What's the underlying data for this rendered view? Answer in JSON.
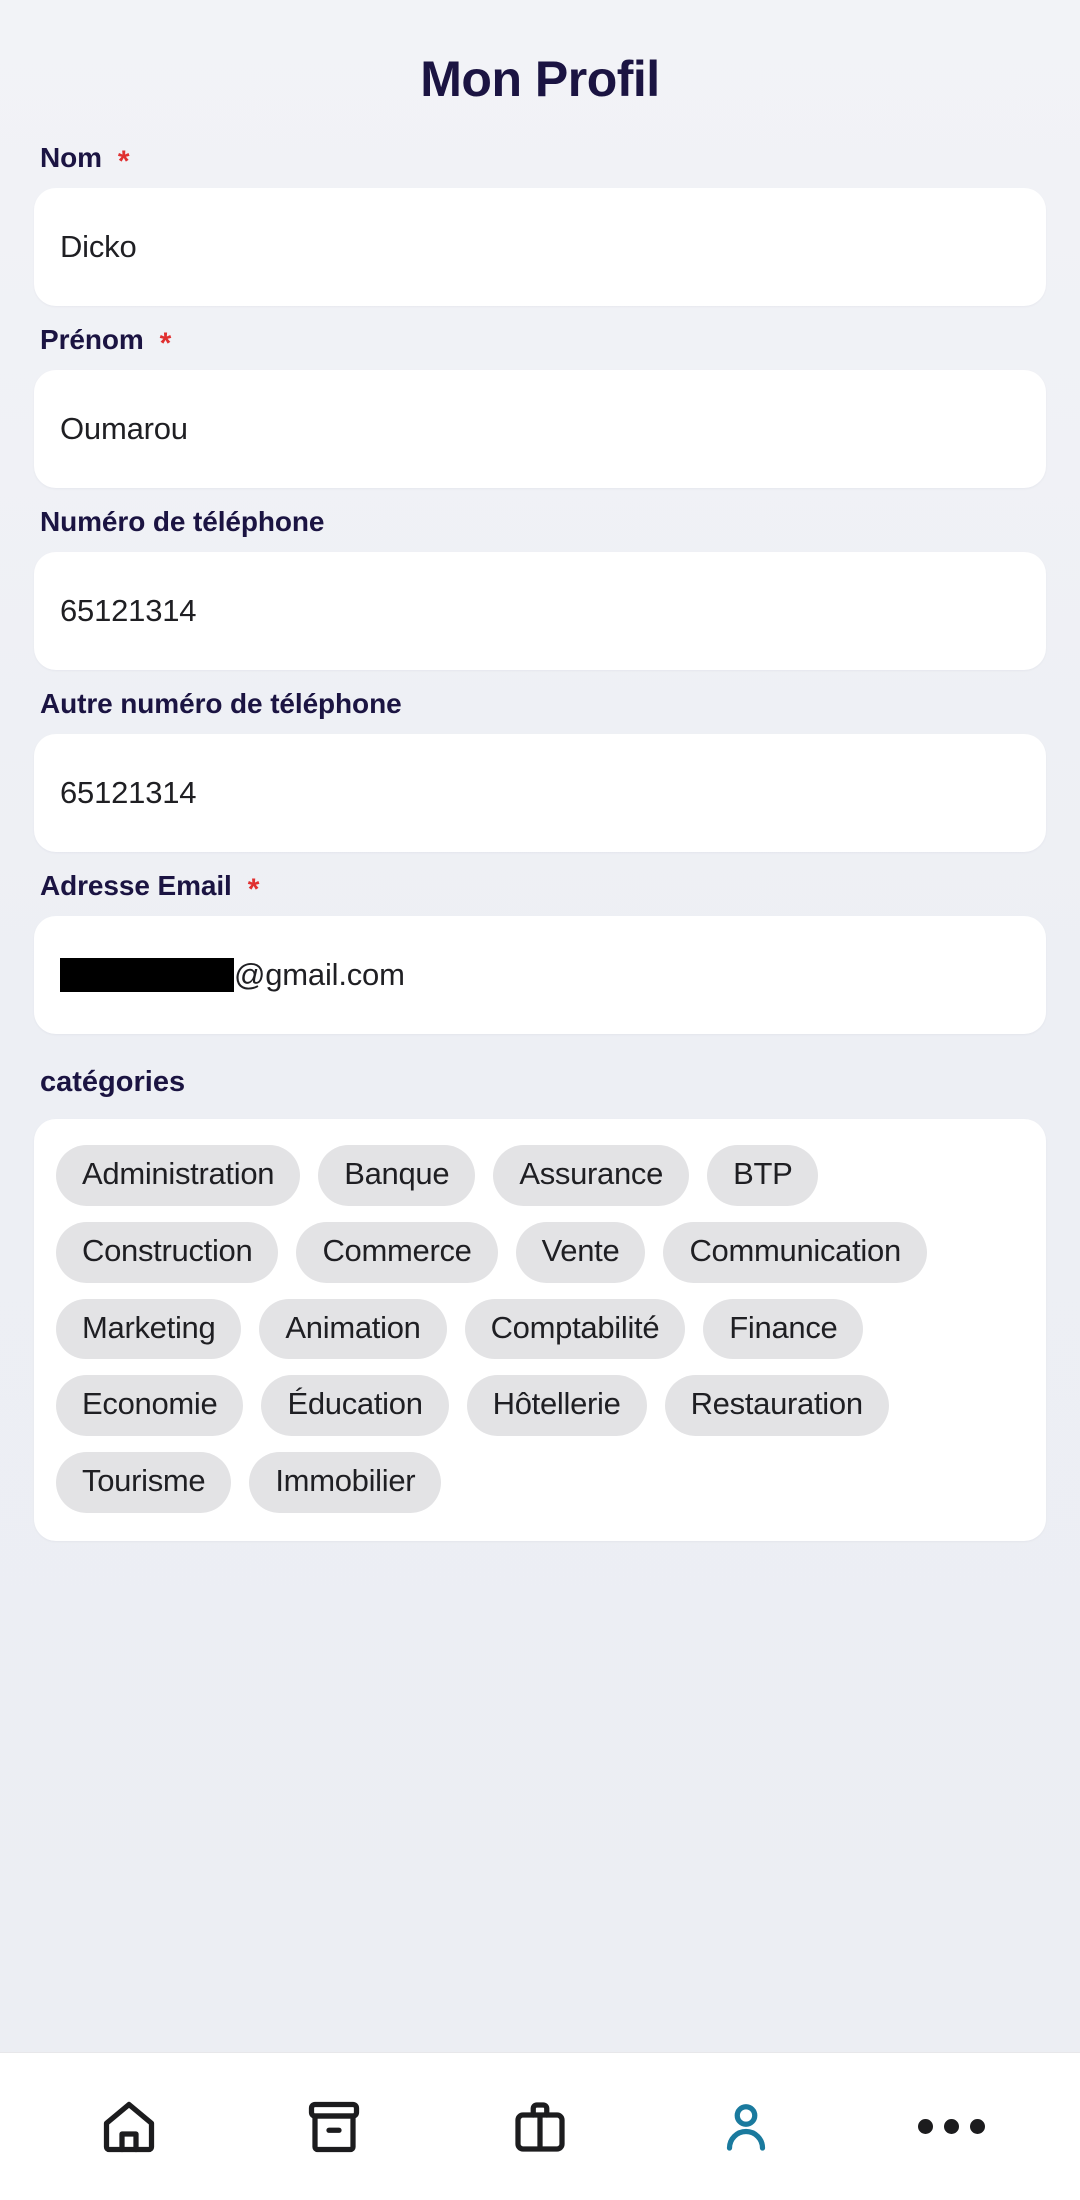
{
  "header": {
    "title": "Mon Profil"
  },
  "form": {
    "required_marker": "*",
    "fields": [
      {
        "label": "Nom",
        "required": true,
        "value": "Dicko",
        "name": "nom"
      },
      {
        "label": "Prénom",
        "required": true,
        "value": "Oumarou",
        "name": "prenom"
      },
      {
        "label": "Numéro de téléphone",
        "required": false,
        "value": "65121314",
        "name": "telephone"
      },
      {
        "label": "Autre numéro de téléphone",
        "required": false,
        "value": "65121314",
        "name": "autre-telephone"
      },
      {
        "label": "Adresse Email",
        "required": true,
        "value": "@gmail.com",
        "redacted": true,
        "name": "email"
      }
    ]
  },
  "categories": {
    "label": "catégories",
    "items": [
      "Administration",
      "Banque",
      "Assurance",
      "BTP",
      "Construction",
      "Commerce",
      "Vente",
      "Communication",
      "Marketing",
      "Animation",
      "Comptabilité",
      "Finance",
      "Economie",
      "Éducation",
      "Hôtellerie",
      "Restauration",
      "Tourisme",
      "Immobilier"
    ]
  },
  "bottom_nav": {
    "active_index": 3,
    "active_color": "#1a7a9e",
    "inactive_color": "#1c1c1e",
    "items": [
      {
        "icon": "home-icon",
        "label": "Accueil"
      },
      {
        "icon": "archive-icon",
        "label": "Archive"
      },
      {
        "icon": "briefcase-icon",
        "label": "Emplois"
      },
      {
        "icon": "person-icon",
        "label": "Profil"
      },
      {
        "icon": "more-icon",
        "label": "Plus"
      }
    ]
  },
  "colors": {
    "background": "#eff1f5",
    "card": "#ffffff",
    "label_text": "#1b1442",
    "value_text": "#1f1f23",
    "chip_bg": "#e3e3e5",
    "required_star": "#e03030",
    "accent": "#1a7a9e"
  }
}
